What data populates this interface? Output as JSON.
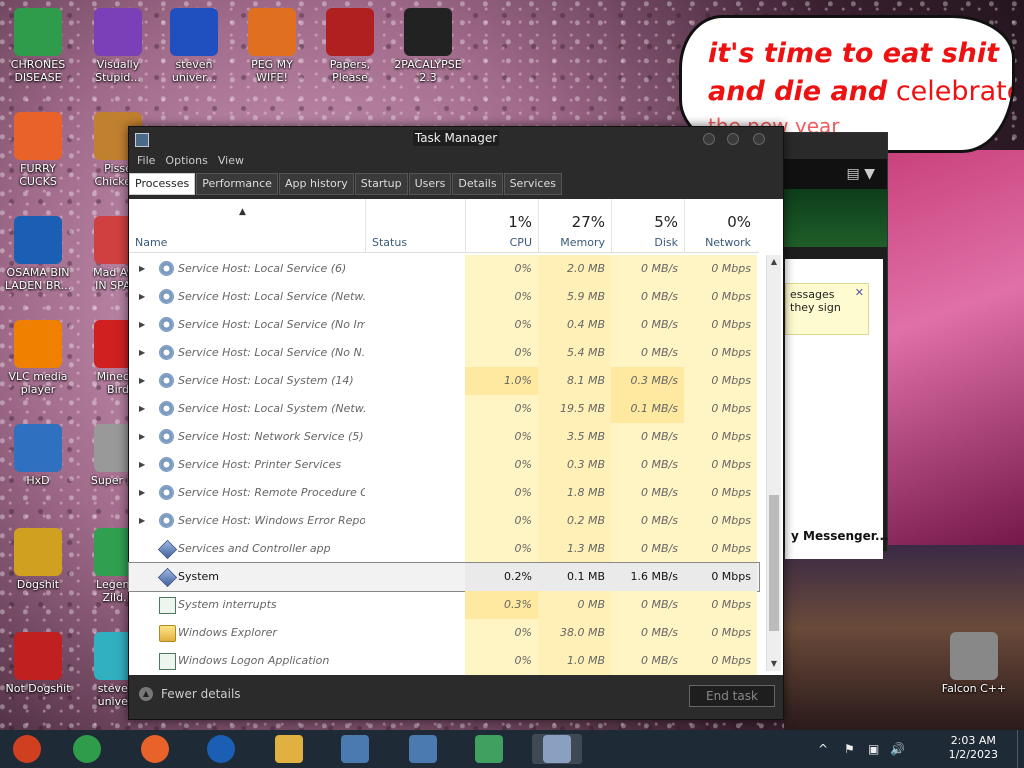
{
  "desktop": {
    "icons": [
      {
        "label": "CHRONES\nDISEASE",
        "icon": "chrome-icon",
        "color": "#2e9c4a"
      },
      {
        "label": "Visually\nStupid...",
        "icon": "visual-studio-icon",
        "color": "#7b3fb8"
      },
      {
        "label": "steven\nuniver...",
        "icon": "number-two-icon",
        "color": "#2050c0"
      },
      {
        "label": "PEG MY WIFE!",
        "icon": "peggle-icon",
        "color": "#e07020"
      },
      {
        "label": "Papers,\nPlease",
        "icon": "eagle-emblem-icon",
        "color": "#b02020"
      },
      {
        "label": "2PACALYPSE\n2.3",
        "icon": "terminal-icon",
        "color": "#222222"
      },
      {
        "label": "FURRY CUCKS",
        "icon": "firefox-icon",
        "color": "#e8622a"
      },
      {
        "label": "Pisse\nChicke...",
        "icon": "game-icon",
        "color": "#c08030"
      },
      {
        "label": "OSAMA BIN\nLADEN BR...",
        "icon": "obama-logo-icon",
        "color": "#1a5fb4"
      },
      {
        "label": "Mad Av...\nIN SPA...",
        "icon": "spiral-icon",
        "color": "#d04040"
      },
      {
        "label": "VLC media\nplayer",
        "icon": "vlc-cone-icon",
        "color": "#f08000"
      },
      {
        "label": "Minec...\nBird",
        "icon": "angry-bird-icon",
        "color": "#d02020"
      },
      {
        "label": "HxD",
        "icon": "hxd-icon",
        "color": "#3070c0"
      },
      {
        "label": "Super H...",
        "icon": "pixel-face-icon",
        "color": "#999999"
      },
      {
        "label": "Dogshit",
        "icon": "codeblocks-icon",
        "color": "#d0a020"
      },
      {
        "label": "Legen...\nZild...",
        "icon": "pixel-hero-icon",
        "color": "#30a050"
      },
      {
        "label": "Not Dogshit",
        "icon": "devcpp-icon",
        "color": "#c02020"
      },
      {
        "label": "steve...\nunive...",
        "icon": "gem-icon",
        "color": "#30b0c0"
      },
      {
        "label": "Falcon C++",
        "icon": "recycle-bin-icon",
        "color": "#888888"
      }
    ]
  },
  "bubble": {
    "line1": "it's time to eat shit",
    "line2a": "and die and",
    "line2b": " celebrate",
    "line3": "the new year"
  },
  "messenger": {
    "dropdown_glyph": "▼",
    "note_line1": "essages",
    "note_line2": "they sign",
    "note_close": "✕",
    "footer_title": "y Messenger..."
  },
  "task_manager": {
    "title": "Task Manager",
    "menu": [
      "File",
      "Options",
      "View"
    ],
    "tabs": [
      "Processes",
      "Performance",
      "App history",
      "Startup",
      "Users",
      "Details",
      "Services"
    ],
    "active_tab": "Processes",
    "columns": {
      "name": "Name",
      "status": "Status",
      "cpu": {
        "pct": "1%",
        "label": "CPU"
      },
      "memory": {
        "pct": "27%",
        "label": "Memory"
      },
      "disk": {
        "pct": "5%",
        "label": "Disk"
      },
      "network": {
        "pct": "0%",
        "label": "Network"
      }
    },
    "rows": [
      {
        "name": "Service Host: Local Service (6)",
        "icon": "gear-icon",
        "expandable": true,
        "cpu": "0%",
        "memory": "2.0 MB",
        "disk": "0 MB/s",
        "network": "0 Mbps"
      },
      {
        "name": "Service Host: Local Service (Netw...",
        "icon": "gear-icon",
        "expandable": true,
        "cpu": "0%",
        "memory": "5.9 MB",
        "disk": "0 MB/s",
        "network": "0 Mbps"
      },
      {
        "name": "Service Host: Local Service (No Im...",
        "icon": "gear-icon",
        "expandable": true,
        "cpu": "0%",
        "memory": "0.4 MB",
        "disk": "0 MB/s",
        "network": "0 Mbps"
      },
      {
        "name": "Service Host: Local Service (No N...",
        "icon": "gear-icon",
        "expandable": true,
        "cpu": "0%",
        "memory": "5.4 MB",
        "disk": "0 MB/s",
        "network": "0 Mbps"
      },
      {
        "name": "Service Host: Local System (14)",
        "icon": "gear-icon",
        "expandable": true,
        "cpu": "1.0%",
        "memory": "8.1 MB",
        "disk": "0.3 MB/s",
        "network": "0 Mbps"
      },
      {
        "name": "Service Host: Local System (Netw...",
        "icon": "gear-icon",
        "expandable": true,
        "cpu": "0%",
        "memory": "19.5 MB",
        "disk": "0.1 MB/s",
        "network": "0 Mbps"
      },
      {
        "name": "Service Host: Network Service (5)",
        "icon": "gear-icon",
        "expandable": true,
        "cpu": "0%",
        "memory": "3.5 MB",
        "disk": "0 MB/s",
        "network": "0 Mbps"
      },
      {
        "name": "Service Host: Printer Services",
        "icon": "gear-icon",
        "expandable": true,
        "cpu": "0%",
        "memory": "0.3 MB",
        "disk": "0 MB/s",
        "network": "0 Mbps"
      },
      {
        "name": "Service Host: Remote Procedure C...",
        "icon": "gear-icon",
        "expandable": true,
        "cpu": "0%",
        "memory": "1.8 MB",
        "disk": "0 MB/s",
        "network": "0 Mbps"
      },
      {
        "name": "Service Host: Windows Error Repo...",
        "icon": "gear-icon",
        "expandable": true,
        "cpu": "0%",
        "memory": "0.2 MB",
        "disk": "0 MB/s",
        "network": "0 Mbps"
      },
      {
        "name": "Services and Controller app",
        "icon": "diamond-icon",
        "expandable": false,
        "cpu": "0%",
        "memory": "1.3 MB",
        "disk": "0 MB/s",
        "network": "0 Mbps"
      },
      {
        "name": "System",
        "icon": "diamond-icon",
        "expandable": false,
        "selected": true,
        "cpu": "0.2%",
        "memory": "0.1 MB",
        "disk": "1.6 MB/s",
        "network": "0 Mbps"
      },
      {
        "name": "System interrupts",
        "icon": "window-icon",
        "expandable": false,
        "cpu": "0.3%",
        "memory": "0 MB",
        "disk": "0 MB/s",
        "network": "0 Mbps"
      },
      {
        "name": "Windows Explorer",
        "icon": "folder-icon",
        "expandable": false,
        "cpu": "0%",
        "memory": "38.0 MB",
        "disk": "0 MB/s",
        "network": "0 Mbps"
      },
      {
        "name": "Windows Logon Application",
        "icon": "window-icon",
        "expandable": false,
        "cpu": "0%",
        "memory": "1.0 MB",
        "disk": "0 MB/s",
        "network": "0 Mbps"
      }
    ],
    "fewer_details": "Fewer details",
    "end_task": "End task"
  },
  "taskbar": {
    "items": [
      "start-icon",
      "chrome-icon",
      "firefox-icon",
      "obama-logo-icon",
      "file-explorer-icon",
      "installer-icon",
      "installer-icon-2",
      "network-users-icon",
      "task-manager-icon"
    ],
    "clock_time": "2:03 AM",
    "clock_date": "1/2/2023",
    "tray_glyphs": {
      "chevron": "^",
      "flag": "⚑",
      "volume": "🔊"
    }
  },
  "colors": {
    "accent_heat": "#fff4c4",
    "window_dark": "#2b2b2b",
    "taskbar": "#1e2a36",
    "bubble_text": "#ee1111"
  }
}
